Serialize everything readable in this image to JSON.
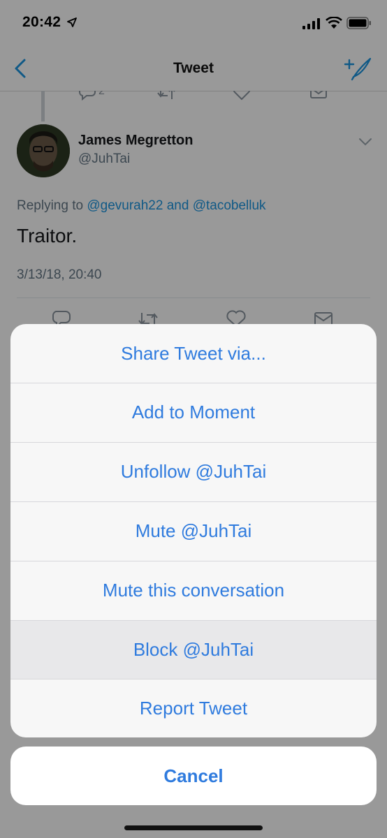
{
  "status_bar": {
    "time": "20:42"
  },
  "nav": {
    "title": "Tweet"
  },
  "thread": {
    "reply_count": "2"
  },
  "tweet": {
    "author_name": "James Megretton",
    "author_handle": "@JuhTai",
    "replying_prefix": "Replying to",
    "mention_1": "@gevurah22",
    "conj": "and",
    "mention_2": "@tacobelluk",
    "text": "Traitor.",
    "timestamp": "3/13/18, 20:40"
  },
  "action_sheet": {
    "items": [
      {
        "label": "Share Tweet via..."
      },
      {
        "label": "Add to Moment"
      },
      {
        "label": "Unfollow @JuhTai"
      },
      {
        "label": "Mute @JuhTai"
      },
      {
        "label": "Mute this conversation"
      },
      {
        "label": "Block @JuhTai"
      },
      {
        "label": "Report Tweet"
      }
    ],
    "highlighted_index": 5,
    "cancel_label": "Cancel"
  },
  "colors": {
    "accent": "#2f7bde",
    "link": "#1b95e0",
    "secondary_text": "#657786"
  },
  "icons": [
    "location-arrow-icon",
    "signal-icon",
    "wifi-icon",
    "battery-icon",
    "back-icon",
    "compose-tweet-icon",
    "reply-icon",
    "retweet-icon",
    "like-icon",
    "share-icon",
    "chevron-down-icon"
  ]
}
